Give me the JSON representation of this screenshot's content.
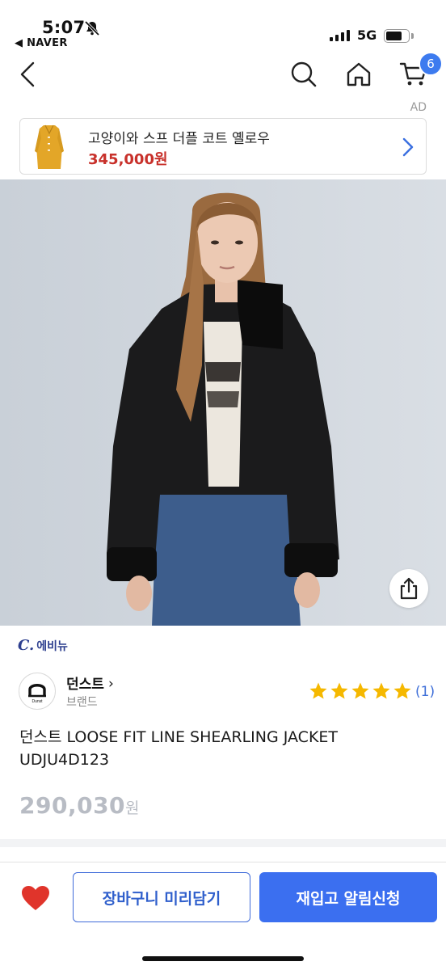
{
  "status_bar": {
    "time": "5:07",
    "back_app": "◀ NAVER",
    "network": "5G"
  },
  "nav": {
    "cart_count": "6"
  },
  "ad": {
    "label": "AD",
    "title": "고양이와 스프 더플 코트 옐로우",
    "price": "345,000원",
    "price_color": "#c8312b"
  },
  "seller": {
    "logo_mark": "C.",
    "name": "에비뉴"
  },
  "brand": {
    "logo_text": "Dunst",
    "name": "던스트",
    "chevron": "›",
    "sub": "브랜드"
  },
  "rating": {
    "stars": 5,
    "review_count": "(1)",
    "star_color": "#f5b800"
  },
  "product": {
    "name": "던스트 LOOSE FIT LINE SHEARLING JACKET UDJU4D123",
    "price": "290,030",
    "price_unit": "원"
  },
  "bottom_bar": {
    "cart_label": "장바구니 미리담기",
    "notify_label": "재입고 알림신청",
    "accent_color": "#3b6ff0",
    "heart_color": "#e0342b"
  }
}
